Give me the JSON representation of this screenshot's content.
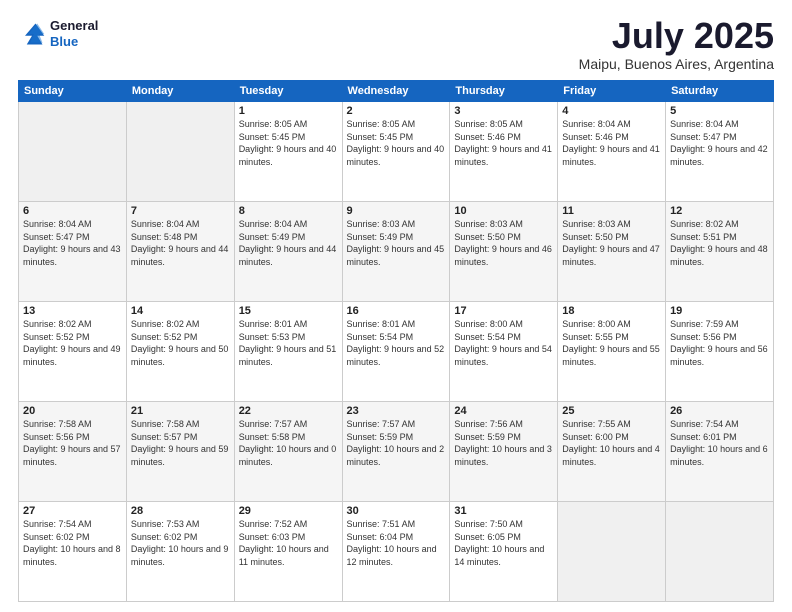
{
  "header": {
    "logo_line1": "General",
    "logo_line2": "Blue",
    "title": "July 2025",
    "subtitle": "Maipu, Buenos Aires, Argentina"
  },
  "weekdays": [
    "Sunday",
    "Monday",
    "Tuesday",
    "Wednesday",
    "Thursday",
    "Friday",
    "Saturday"
  ],
  "weeks": [
    [
      {
        "day": "",
        "detail": ""
      },
      {
        "day": "",
        "detail": ""
      },
      {
        "day": "1",
        "detail": "Sunrise: 8:05 AM\nSunset: 5:45 PM\nDaylight: 9 hours and 40 minutes."
      },
      {
        "day": "2",
        "detail": "Sunrise: 8:05 AM\nSunset: 5:45 PM\nDaylight: 9 hours and 40 minutes."
      },
      {
        "day": "3",
        "detail": "Sunrise: 8:05 AM\nSunset: 5:46 PM\nDaylight: 9 hours and 41 minutes."
      },
      {
        "day": "4",
        "detail": "Sunrise: 8:04 AM\nSunset: 5:46 PM\nDaylight: 9 hours and 41 minutes."
      },
      {
        "day": "5",
        "detail": "Sunrise: 8:04 AM\nSunset: 5:47 PM\nDaylight: 9 hours and 42 minutes."
      }
    ],
    [
      {
        "day": "6",
        "detail": "Sunrise: 8:04 AM\nSunset: 5:47 PM\nDaylight: 9 hours and 43 minutes."
      },
      {
        "day": "7",
        "detail": "Sunrise: 8:04 AM\nSunset: 5:48 PM\nDaylight: 9 hours and 44 minutes."
      },
      {
        "day": "8",
        "detail": "Sunrise: 8:04 AM\nSunset: 5:49 PM\nDaylight: 9 hours and 44 minutes."
      },
      {
        "day": "9",
        "detail": "Sunrise: 8:03 AM\nSunset: 5:49 PM\nDaylight: 9 hours and 45 minutes."
      },
      {
        "day": "10",
        "detail": "Sunrise: 8:03 AM\nSunset: 5:50 PM\nDaylight: 9 hours and 46 minutes."
      },
      {
        "day": "11",
        "detail": "Sunrise: 8:03 AM\nSunset: 5:50 PM\nDaylight: 9 hours and 47 minutes."
      },
      {
        "day": "12",
        "detail": "Sunrise: 8:02 AM\nSunset: 5:51 PM\nDaylight: 9 hours and 48 minutes."
      }
    ],
    [
      {
        "day": "13",
        "detail": "Sunrise: 8:02 AM\nSunset: 5:52 PM\nDaylight: 9 hours and 49 minutes."
      },
      {
        "day": "14",
        "detail": "Sunrise: 8:02 AM\nSunset: 5:52 PM\nDaylight: 9 hours and 50 minutes."
      },
      {
        "day": "15",
        "detail": "Sunrise: 8:01 AM\nSunset: 5:53 PM\nDaylight: 9 hours and 51 minutes."
      },
      {
        "day": "16",
        "detail": "Sunrise: 8:01 AM\nSunset: 5:54 PM\nDaylight: 9 hours and 52 minutes."
      },
      {
        "day": "17",
        "detail": "Sunrise: 8:00 AM\nSunset: 5:54 PM\nDaylight: 9 hours and 54 minutes."
      },
      {
        "day": "18",
        "detail": "Sunrise: 8:00 AM\nSunset: 5:55 PM\nDaylight: 9 hours and 55 minutes."
      },
      {
        "day": "19",
        "detail": "Sunrise: 7:59 AM\nSunset: 5:56 PM\nDaylight: 9 hours and 56 minutes."
      }
    ],
    [
      {
        "day": "20",
        "detail": "Sunrise: 7:58 AM\nSunset: 5:56 PM\nDaylight: 9 hours and 57 minutes."
      },
      {
        "day": "21",
        "detail": "Sunrise: 7:58 AM\nSunset: 5:57 PM\nDaylight: 9 hours and 59 minutes."
      },
      {
        "day": "22",
        "detail": "Sunrise: 7:57 AM\nSunset: 5:58 PM\nDaylight: 10 hours and 0 minutes."
      },
      {
        "day": "23",
        "detail": "Sunrise: 7:57 AM\nSunset: 5:59 PM\nDaylight: 10 hours and 2 minutes."
      },
      {
        "day": "24",
        "detail": "Sunrise: 7:56 AM\nSunset: 5:59 PM\nDaylight: 10 hours and 3 minutes."
      },
      {
        "day": "25",
        "detail": "Sunrise: 7:55 AM\nSunset: 6:00 PM\nDaylight: 10 hours and 4 minutes."
      },
      {
        "day": "26",
        "detail": "Sunrise: 7:54 AM\nSunset: 6:01 PM\nDaylight: 10 hours and 6 minutes."
      }
    ],
    [
      {
        "day": "27",
        "detail": "Sunrise: 7:54 AM\nSunset: 6:02 PM\nDaylight: 10 hours and 8 minutes."
      },
      {
        "day": "28",
        "detail": "Sunrise: 7:53 AM\nSunset: 6:02 PM\nDaylight: 10 hours and 9 minutes."
      },
      {
        "day": "29",
        "detail": "Sunrise: 7:52 AM\nSunset: 6:03 PM\nDaylight: 10 hours and 11 minutes."
      },
      {
        "day": "30",
        "detail": "Sunrise: 7:51 AM\nSunset: 6:04 PM\nDaylight: 10 hours and 12 minutes."
      },
      {
        "day": "31",
        "detail": "Sunrise: 7:50 AM\nSunset: 6:05 PM\nDaylight: 10 hours and 14 minutes."
      },
      {
        "day": "",
        "detail": ""
      },
      {
        "day": "",
        "detail": ""
      }
    ]
  ]
}
